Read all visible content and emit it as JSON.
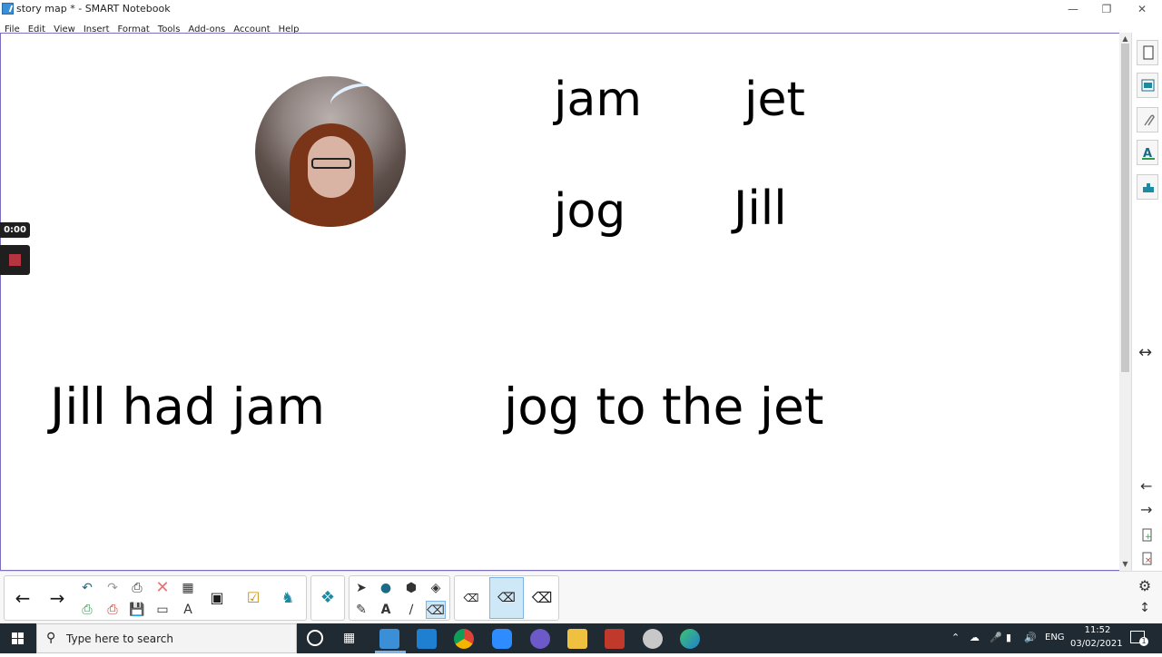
{
  "window": {
    "title": "story map * - SMART Notebook",
    "minimize": "—",
    "restore": "❐",
    "close": "✕"
  },
  "menu": [
    "File",
    "Edit",
    "View",
    "Insert",
    "Format",
    "Tools",
    "Add-ons",
    "Account",
    "Help"
  ],
  "canvas": {
    "words": {
      "jam": "jam",
      "jet": "jet",
      "jog": "jog",
      "jill": "Jill"
    },
    "sentence_left": "Jill had jam",
    "sentence_right": "jog to the jet"
  },
  "recorder": {
    "timer": "0:00"
  },
  "sidebar": {
    "icons": [
      "page-sorter-icon",
      "gallery-icon",
      "attachments-icon",
      "properties-icon",
      "addons-icon"
    ],
    "arrows": {
      "swap": "↔",
      "left": "←",
      "right": "→"
    }
  },
  "toolbar": {
    "back": "←",
    "forward": "→",
    "settings": "⚙"
  },
  "taskbar": {
    "search_placeholder": "Type here to search",
    "language": "ENG",
    "time": "11:52",
    "date": "03/02/2021",
    "notification_count": "1"
  },
  "colors": {
    "accent": "#7b6fc0",
    "taskbar": "#1f2a33",
    "teal_icon": "#1b8aa3",
    "record_red": "#b5343f"
  }
}
